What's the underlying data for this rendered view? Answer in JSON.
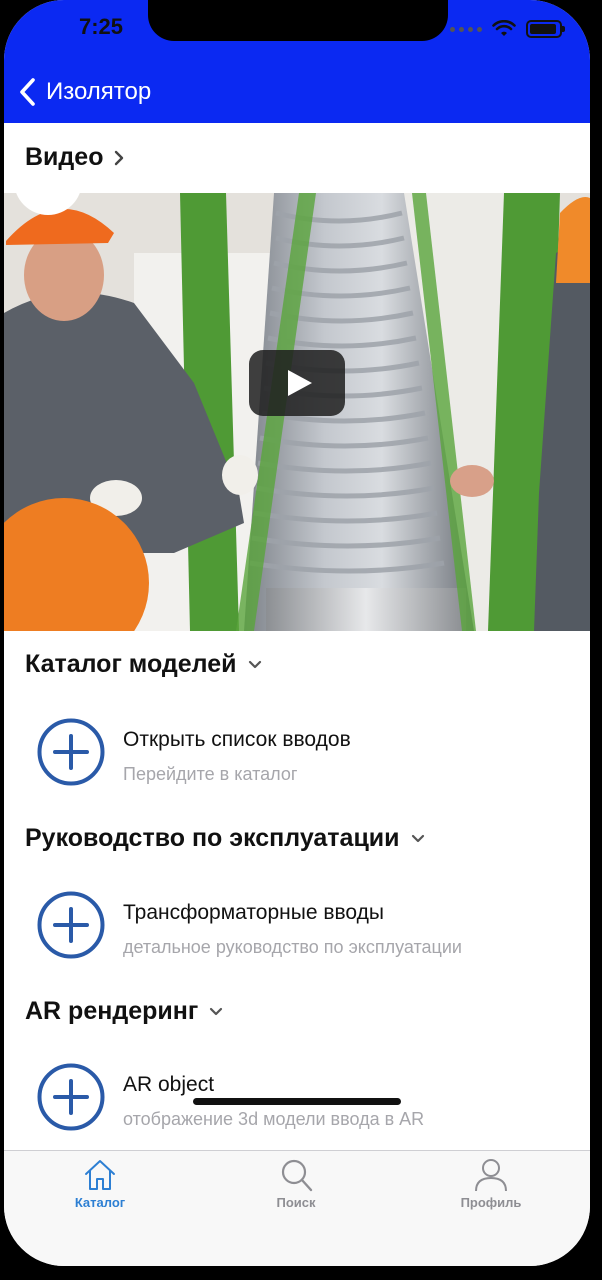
{
  "status_bar": {
    "time": "7:25"
  },
  "nav": {
    "back_title": "Изолятор"
  },
  "video_section": {
    "title": "Видео"
  },
  "catalog_section": {
    "title": "Каталог моделей",
    "item": {
      "title": "Открыть список вводов",
      "subtitle": "Перейдите в каталог"
    }
  },
  "manual_section": {
    "title": "Руководство по эксплуатации",
    "item": {
      "title": "Трансформаторные вводы",
      "subtitle": "детальное руководство по эксплуатации"
    }
  },
  "ar_section": {
    "title": "AR рендеринг",
    "item": {
      "title": "AR object",
      "subtitle": "отображение 3d модели ввода в AR"
    }
  },
  "tabbar": {
    "tabs": [
      {
        "label": "Каталог",
        "icon": "home-icon",
        "active": true
      },
      {
        "label": "Поиск",
        "icon": "search-icon",
        "active": false
      },
      {
        "label": "Профиль",
        "icon": "profile-icon",
        "active": false
      }
    ]
  },
  "colors": {
    "nav_bar": "#0b29f2",
    "accent": "#2a5aa8",
    "tab_active": "#2d7fd3",
    "tab_inactive": "#8e8e93",
    "subtitle": "#a6a6ab"
  }
}
